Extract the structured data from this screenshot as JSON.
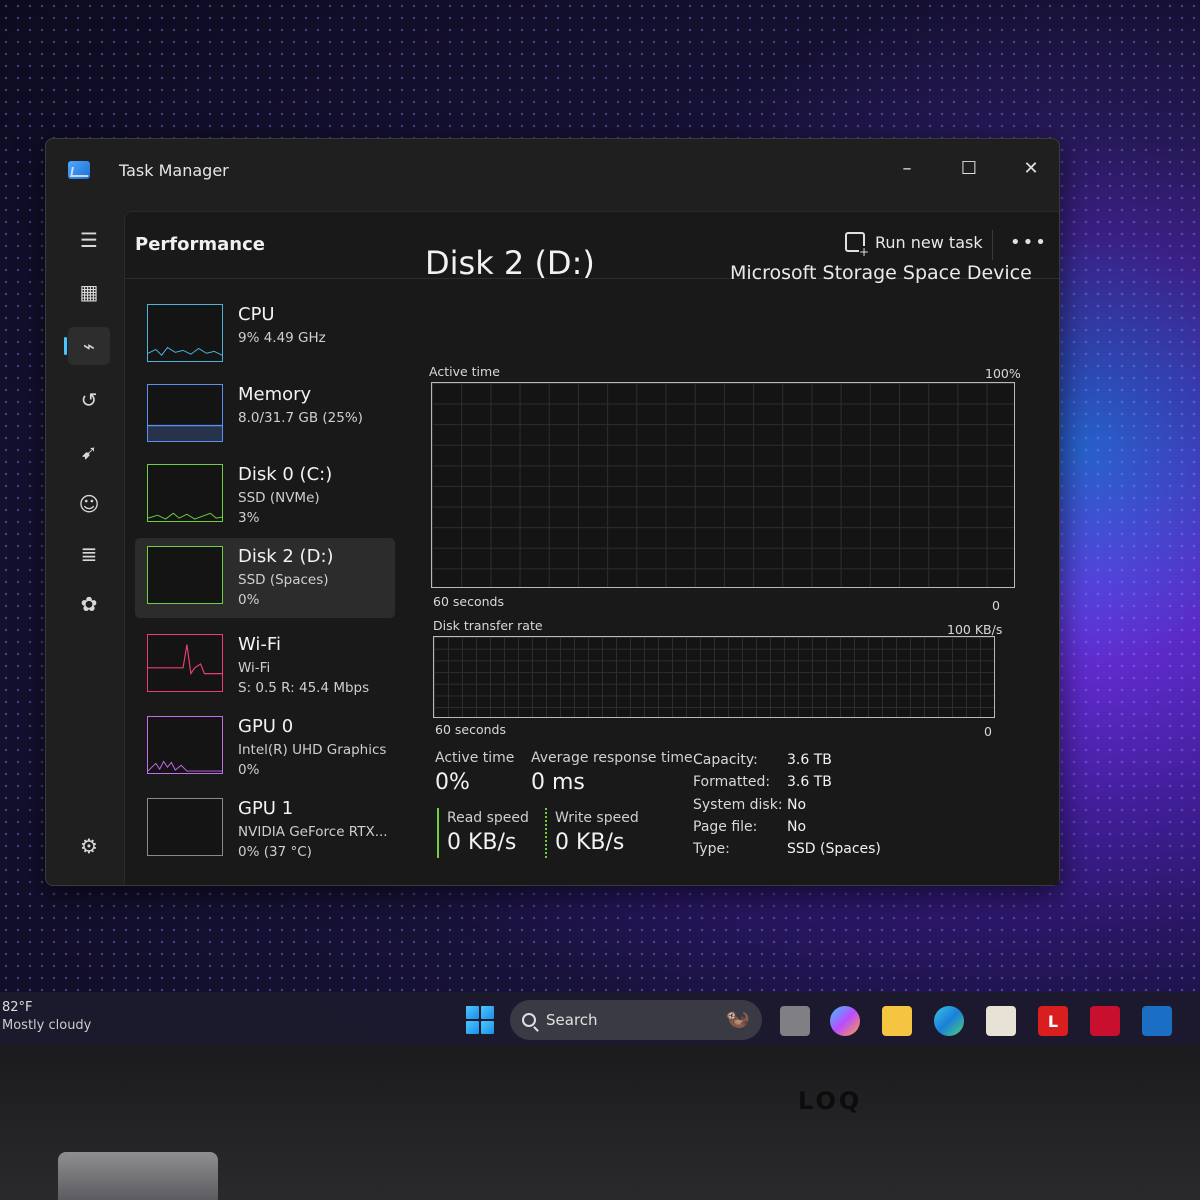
{
  "window": {
    "title": "Task Manager",
    "page_title": "Performance",
    "run_new_task": "Run new task",
    "more": "•••",
    "minimize": "–",
    "maximize": "☐",
    "close": "✕"
  },
  "nav": [
    "hamburger-menu",
    "processes",
    "performance",
    "app-history",
    "startup-apps",
    "users",
    "details",
    "services",
    "settings"
  ],
  "devices": [
    {
      "name": "CPU",
      "line1": "9%  4.49 GHz",
      "line2": "",
      "color": "#4fb3d9"
    },
    {
      "name": "Memory",
      "line1": "8.0/31.7 GB (25%)",
      "line2": "",
      "color": "#5b8ff0"
    },
    {
      "name": "Disk 0 (C:)",
      "line1": "SSD (NVMe)",
      "line2": "3%",
      "color": "#6fcf3f"
    },
    {
      "name": "Disk 2 (D:)",
      "line1": "SSD (Spaces)",
      "line2": "0%",
      "color": "#6fcf3f"
    },
    {
      "name": "Wi-Fi",
      "line1": "Wi-Fi",
      "line2": "S: 0.5  R: 45.4 Mbps",
      "color": "#e83f6f"
    },
    {
      "name": "GPU 0",
      "line1": "Intel(R) UHD Graphics",
      "line2": "0%",
      "color": "#c36de8"
    },
    {
      "name": "GPU 1",
      "line1": "NVIDIA GeForce RTX...",
      "line2": "0%  (37 °C)",
      "color": "#c36de8"
    }
  ],
  "detail": {
    "title": "Disk 2 (D:)",
    "model": "Microsoft Storage Space Device",
    "graph1": {
      "label": "Active time",
      "max": "100%",
      "xlabel": "60 seconds",
      "min": "0"
    },
    "graph2": {
      "label": "Disk transfer rate",
      "max": "100 KB/s",
      "xlabel": "60 seconds",
      "min": "0"
    },
    "stats": {
      "active_time_label": "Active time",
      "active_time_value": "0%",
      "response_label": "Average response time",
      "response_value": "0 ms",
      "read_label": "Read speed",
      "read_value": "0 KB/s",
      "write_label": "Write speed",
      "write_value": "0 KB/s"
    },
    "properties": [
      {
        "key": "Capacity:",
        "value": "3.6 TB"
      },
      {
        "key": "Formatted:",
        "value": "3.6 TB"
      },
      {
        "key": "System disk:",
        "value": "No"
      },
      {
        "key": "Page file:",
        "value": "No"
      },
      {
        "key": "Type:",
        "value": "SSD (Spaces)"
      }
    ]
  },
  "taskbar": {
    "weather_temp": "82°F",
    "weather_desc": "Mostly cloudy",
    "search_placeholder": "Search",
    "lenovo_letter": "L"
  },
  "brand": "LOQ"
}
